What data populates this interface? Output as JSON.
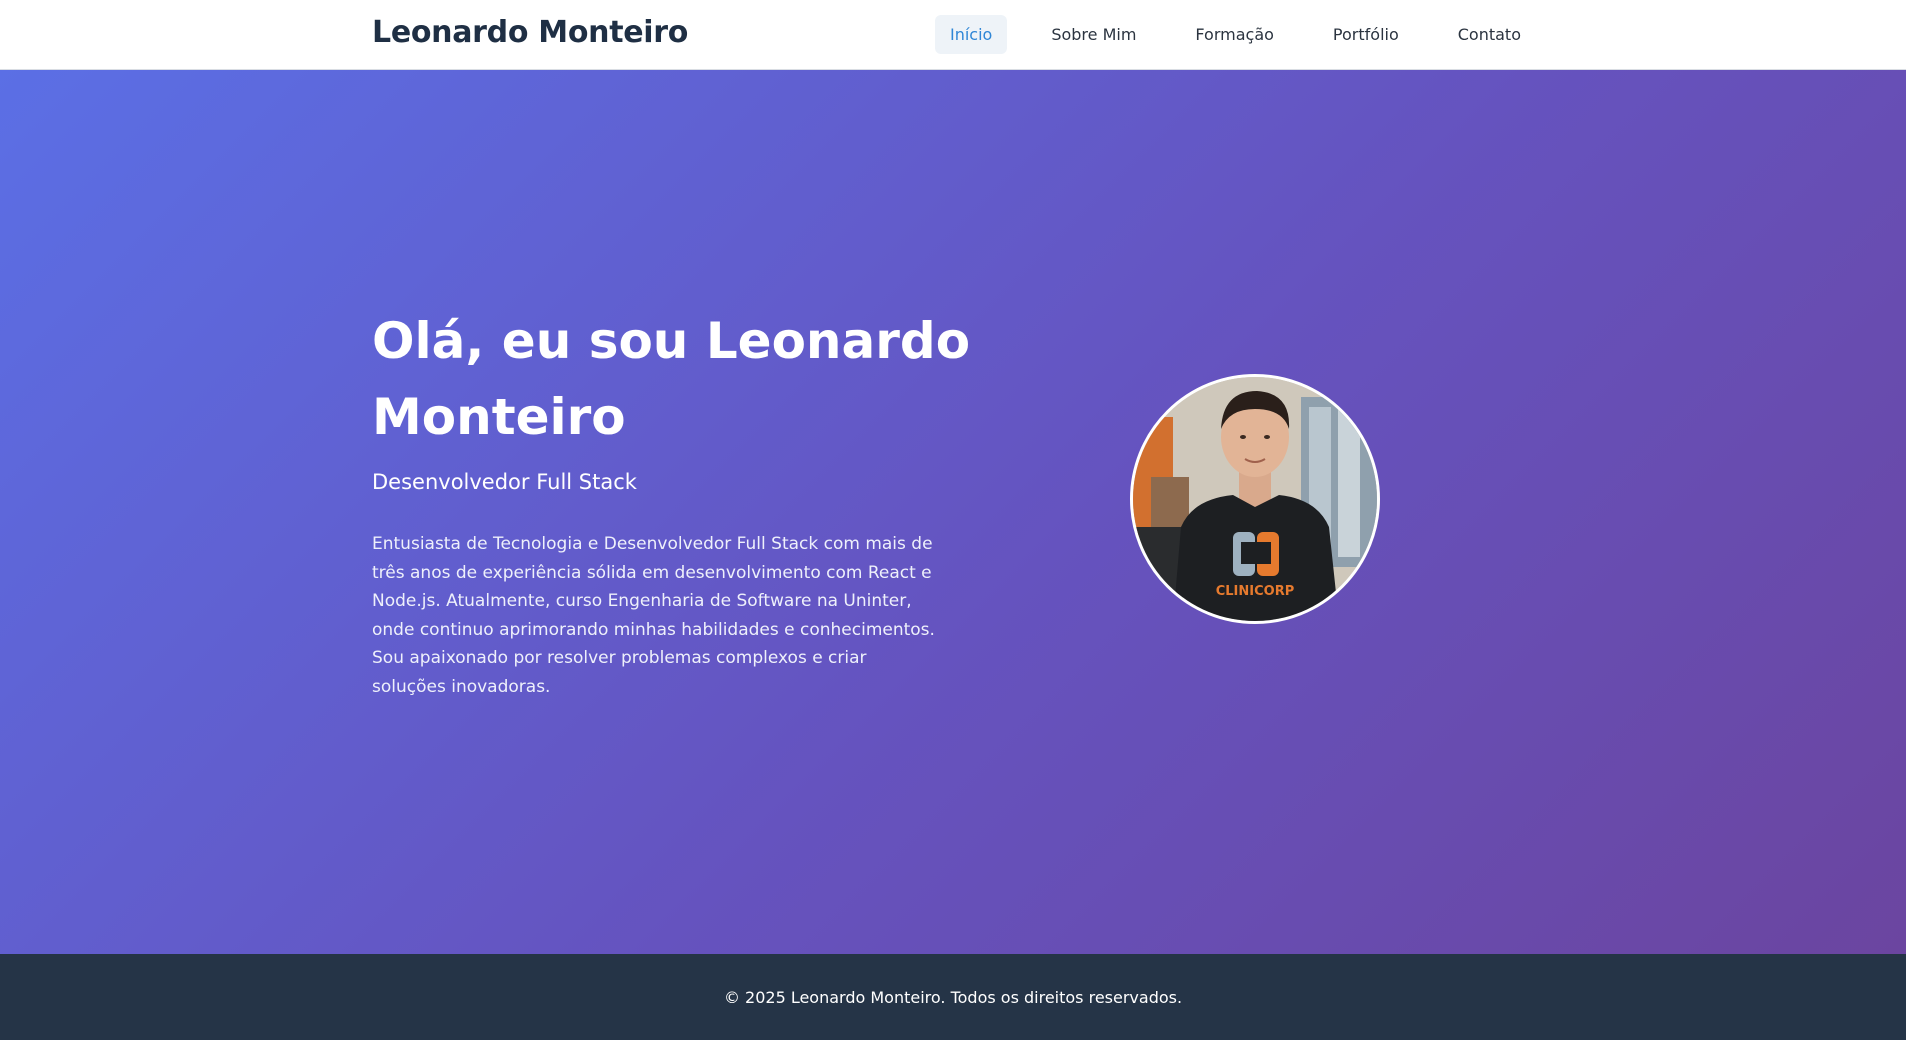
{
  "header": {
    "brand": "Leonardo Monteiro",
    "nav": [
      {
        "label": "Início",
        "active": true
      },
      {
        "label": "Sobre Mim",
        "active": false
      },
      {
        "label": "Formação",
        "active": false
      },
      {
        "label": "Portfólio",
        "active": false
      },
      {
        "label": "Contato",
        "active": false
      }
    ]
  },
  "hero": {
    "title": "Olá, eu sou Leonardo Monteiro",
    "subtitle": "Desenvolvedor Full Stack",
    "description": "Entusiasta de Tecnologia e Desenvolvedor Full Stack com mais de três anos de experiência sólida em desenvolvimento com React e Node.js. Atualmente, curso Engenharia de Software na Uninter, onde continuo aprimorando minhas habilidades e conhecimentos. Sou apaixonado por resolver problemas complexos e criar soluções inovadoras.",
    "photo_shirt_logo": "CLINICORP"
  },
  "footer": {
    "copyright": "© 2025 Leonardo Monteiro. Todos os direitos reservados."
  },
  "colors": {
    "brand_text": "#1f2f44",
    "nav_active": "#2f86d6",
    "hero_gradient_start": "#5b6fe5",
    "hero_gradient_end": "#6b45a0",
    "footer_bg": "#253447"
  }
}
